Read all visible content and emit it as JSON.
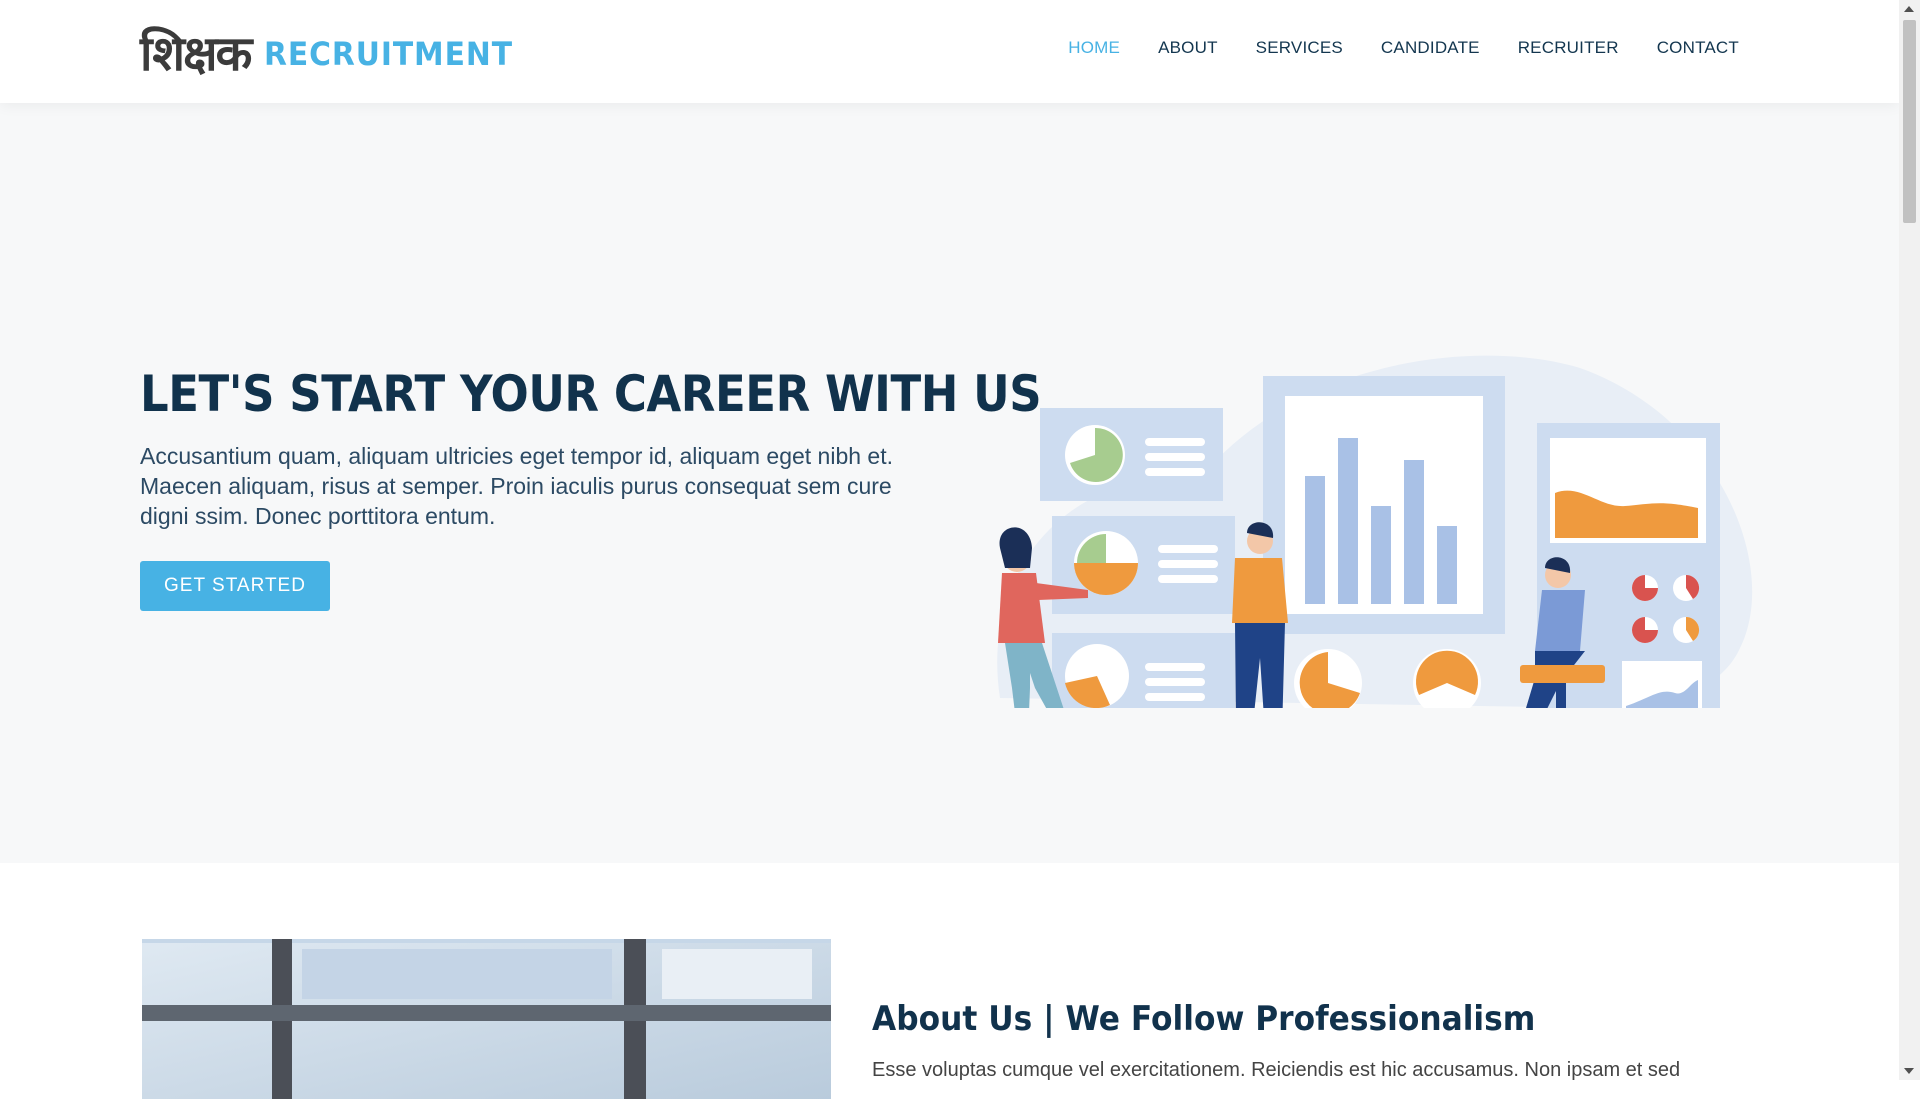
{
  "brand": {
    "mark": "शिक्षक",
    "name": "RECRUITMENT",
    "accent_color": "#47b2e4"
  },
  "nav": {
    "items": [
      {
        "label": "HOME",
        "active": true
      },
      {
        "label": "ABOUT",
        "active": false
      },
      {
        "label": "SERVICES",
        "active": false
      },
      {
        "label": "CANDIDATE",
        "active": false
      },
      {
        "label": "RECRUITER",
        "active": false
      },
      {
        "label": "CONTACT",
        "active": false
      }
    ]
  },
  "hero": {
    "title": "LET'S START YOUR CAREER WITH US",
    "text": "Accusantium quam, aliquam ultricies eget tempor id, aliquam eget nibh et. Maecen aliquam, risus at semper. Proin iaculis purus consequat sem cure digni ssim. Donec porttitora entum.",
    "button_label": "GET STARTED",
    "illustration": "business-team-analytics-illustration"
  },
  "about": {
    "image": "office-window-photo",
    "title": "About Us | We Follow Professionalism",
    "text": "Esse voluptas cumque vel exercitationem. Reiciendis est hic accusamus. Non ipsam et sed"
  },
  "colors": {
    "heading": "#11324c",
    "hero_bg": "#f7f8f9",
    "button": "#47b2e4"
  }
}
